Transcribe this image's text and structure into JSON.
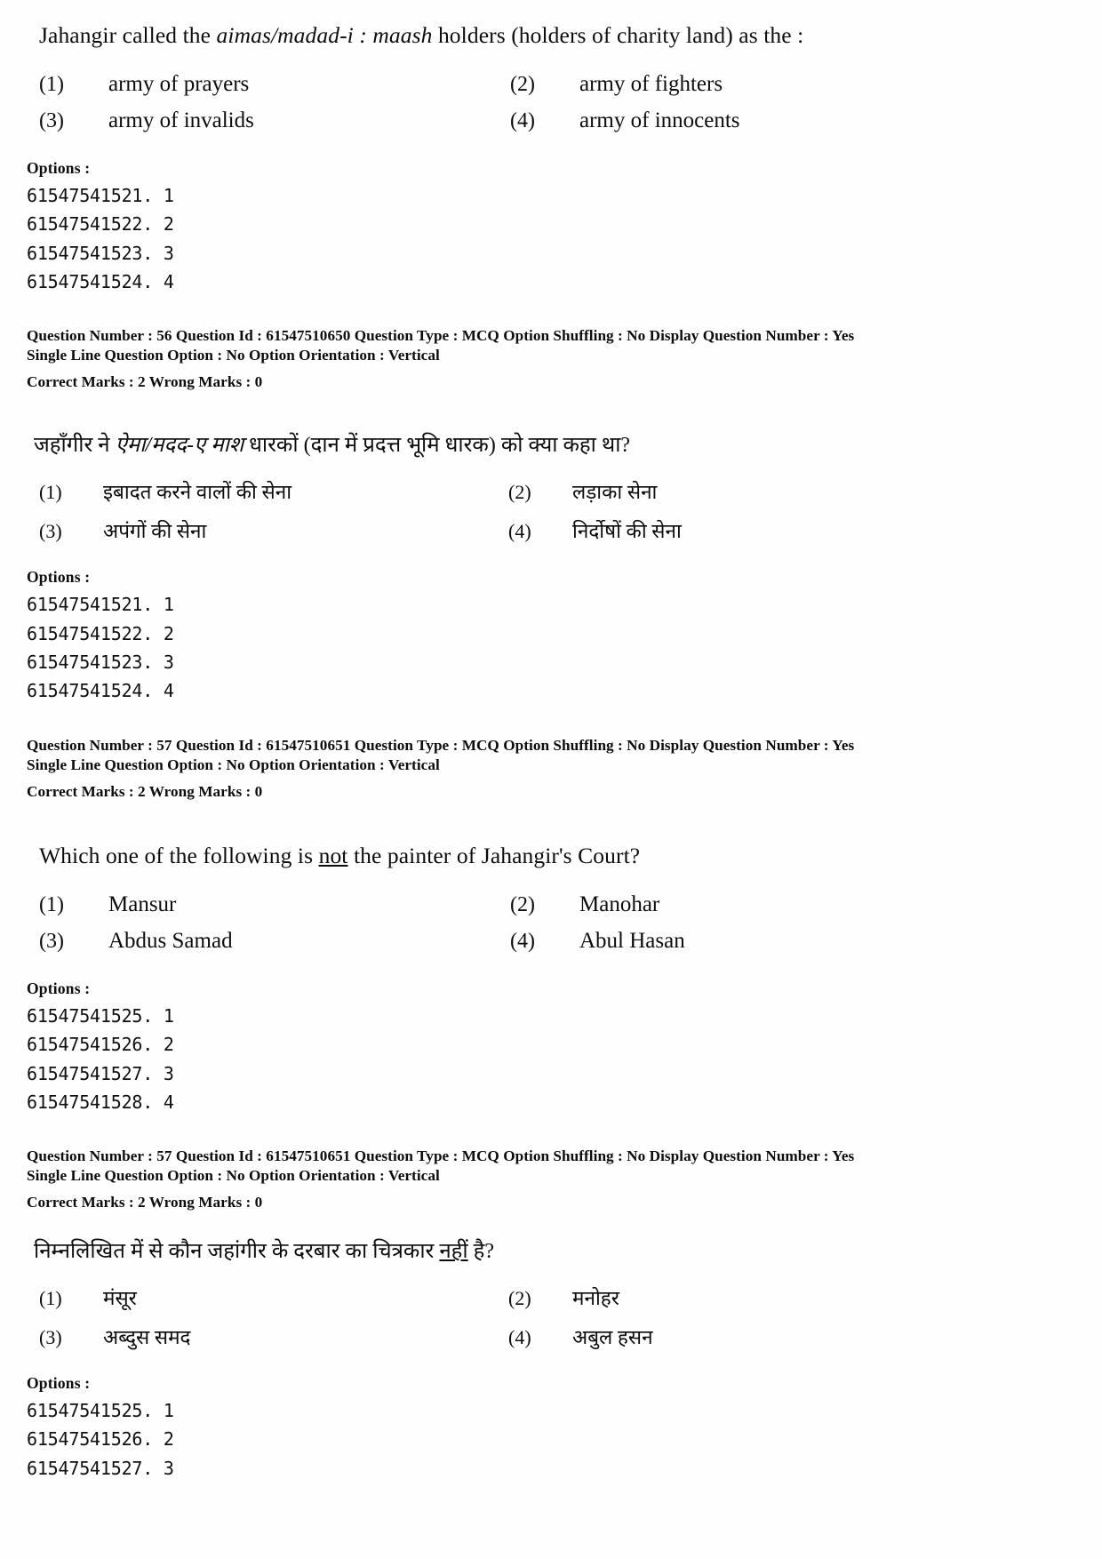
{
  "questions": [
    {
      "stem_pre": "Jahangir called the ",
      "stem_italic": "aimas/madad-i : maash",
      "stem_post": " holders (holders of charity land) as the :",
      "choices": [
        {
          "label": "(1)",
          "text": "army of prayers"
        },
        {
          "label": "(2)",
          "text": "army of fighters"
        },
        {
          "label": "(3)",
          "text": "army of invalids"
        },
        {
          "label": "(4)",
          "text": "army of innocents"
        }
      ],
      "options_label": "Options :",
      "option_ids": [
        "61547541521. 1",
        "61547541522. 2",
        "61547541523. 3",
        "61547541524. 4"
      ],
      "meta_line1": "Question Number : 56  Question Id : 61547510650  Question Type : MCQ  Option Shuffling : No  Display Question Number : Yes",
      "meta_line2": "Single Line Question Option : No  Option Orientation : Vertical",
      "meta_marks": "Correct Marks : 2  Wrong Marks : 0"
    },
    {
      "stem_pre": "जहाँगीर ने ",
      "stem_italic": "ऐमा/मदद-ए माश",
      "stem_post": " धारकों (दान में प्रदत्त भूमि धारक) को क्या कहा था?",
      "choices": [
        {
          "label": "(1)",
          "text": "इबादत करने वालों की सेना"
        },
        {
          "label": "(2)",
          "text": "लड़ाका सेना"
        },
        {
          "label": "(3)",
          "text": "अपंगों की सेना"
        },
        {
          "label": "(4)",
          "text": "निर्दोषों की सेना"
        }
      ],
      "options_label": "Options :",
      "option_ids": [
        "61547541521. 1",
        "61547541522. 2",
        "61547541523. 3",
        "61547541524. 4"
      ],
      "meta_line1": "Question Number : 57  Question Id : 61547510651  Question Type : MCQ  Option Shuffling : No  Display Question Number : Yes",
      "meta_line2": "Single Line Question Option : No  Option Orientation : Vertical",
      "meta_marks": "Correct Marks : 2  Wrong Marks : 0"
    },
    {
      "stem_pre": "Which one of the following is ",
      "stem_underline": "not",
      "stem_post": " the painter of Jahangir's Court?",
      "choices": [
        {
          "label": "(1)",
          "text": "Mansur"
        },
        {
          "label": "(2)",
          "text": "Manohar"
        },
        {
          "label": "(3)",
          "text": "Abdus Samad"
        },
        {
          "label": "(4)",
          "text": "Abul Hasan"
        }
      ],
      "options_label": "Options :",
      "option_ids": [
        "61547541525. 1",
        "61547541526. 2",
        "61547541527. 3",
        "61547541528. 4"
      ],
      "meta_line1": "Question Number : 57  Question Id : 61547510651  Question Type : MCQ  Option Shuffling : No  Display Question Number : Yes",
      "meta_line2": "Single Line Question Option : No  Option Orientation : Vertical",
      "meta_marks": "Correct Marks : 2  Wrong Marks : 0"
    },
    {
      "stem_pre": "निम्नलिखित में से कौन जहांगीर के दरबार का चित्रकार ",
      "stem_underline": "नहीं",
      "stem_post": " है?",
      "choices": [
        {
          "label": "(1)",
          "text": "मंसूर"
        },
        {
          "label": "(2)",
          "text": "मनोहर"
        },
        {
          "label": "(3)",
          "text": "अब्दुस समद"
        },
        {
          "label": "(4)",
          "text": "अबुल हसन"
        }
      ],
      "options_label": "Options :",
      "option_ids": [
        "61547541525. 1",
        "61547541526. 2",
        "61547541527. 3"
      ]
    }
  ]
}
